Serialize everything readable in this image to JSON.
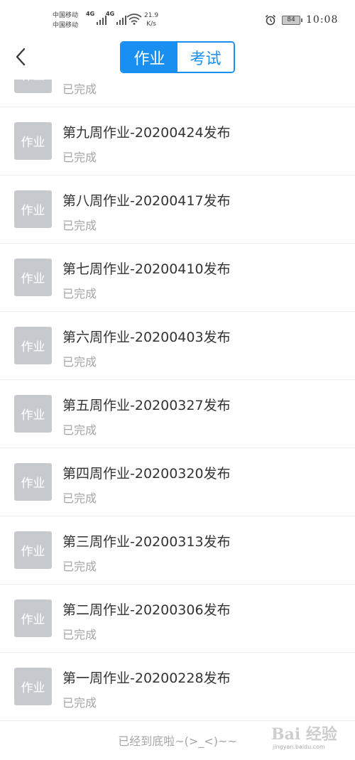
{
  "status_bar": {
    "carrier_1": "中国移动",
    "carrier_2": "中国移动",
    "net_type_1": "4G",
    "net_type_2": "4G",
    "speed_value": "21.9",
    "speed_unit": "K/s",
    "battery": "84",
    "time": "10:08",
    "icons": [
      "signal-icon",
      "wifi-icon",
      "alarm-icon",
      "battery-icon"
    ]
  },
  "header": {
    "back_icon": "chevron-left-icon",
    "tabs": [
      {
        "label": "作业",
        "active": true
      },
      {
        "label": "考试",
        "active": false
      }
    ]
  },
  "list": {
    "thumb_label": "作业",
    "partial_status": "已完成",
    "items": [
      {
        "title": "第九周作业-20200424发布",
        "status": "已完成"
      },
      {
        "title": "第八周作业-20200417发布",
        "status": "已完成"
      },
      {
        "title": "第七周作业-20200410发布",
        "status": "已完成"
      },
      {
        "title": "第六周作业-20200403发布",
        "status": "已完成"
      },
      {
        "title": "第五周作业-20200327发布",
        "status": "已完成"
      },
      {
        "title": "第四周作业-20200320发布",
        "status": "已完成"
      },
      {
        "title": "第三周作业-20200313发布",
        "status": "已完成"
      },
      {
        "title": "第二周作业-20200306发布",
        "status": "已完成"
      },
      {
        "title": "第一周作业-20200228发布",
        "status": "已完成"
      }
    ]
  },
  "footer": {
    "end_text": "已经到底啦~(>_<)~~"
  },
  "watermark": {
    "text": "Bai 经验",
    "url_text": "jingyan.baidu.com"
  },
  "colors": {
    "accent": "#1a8ff2",
    "thumb_bg": "#c6cacf",
    "status_gray": "#a4a4a4"
  }
}
